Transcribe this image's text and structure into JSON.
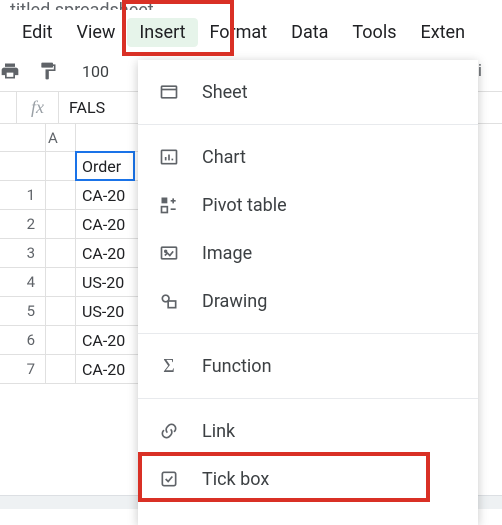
{
  "title_fragment": "titled spreadsheet",
  "menubar": {
    "edit": "Edit",
    "view": "View",
    "insert": "Insert",
    "format": "Format",
    "data": "Data",
    "tools": "Tools",
    "extensions": "Exten"
  },
  "toolbar": {
    "zoom": "100",
    "shortcut_hint": "Shi"
  },
  "formula_bar": {
    "fx": "fx",
    "value": "FALS"
  },
  "columns": {
    "A": "A"
  },
  "rows": [
    "1",
    "2",
    "3",
    "4",
    "5",
    "6",
    "7"
  ],
  "header_cell": "Order",
  "data_cells": [
    "CA-20",
    "CA-20",
    "CA-20",
    "US-20",
    "US-20",
    "CA-20",
    "CA-20"
  ],
  "dropdown": {
    "sheet": "Sheet",
    "chart": "Chart",
    "pivot": "Pivot table",
    "image": "Image",
    "drawing": "Drawing",
    "function": "Function",
    "link": "Link",
    "tickbox": "Tick box"
  }
}
